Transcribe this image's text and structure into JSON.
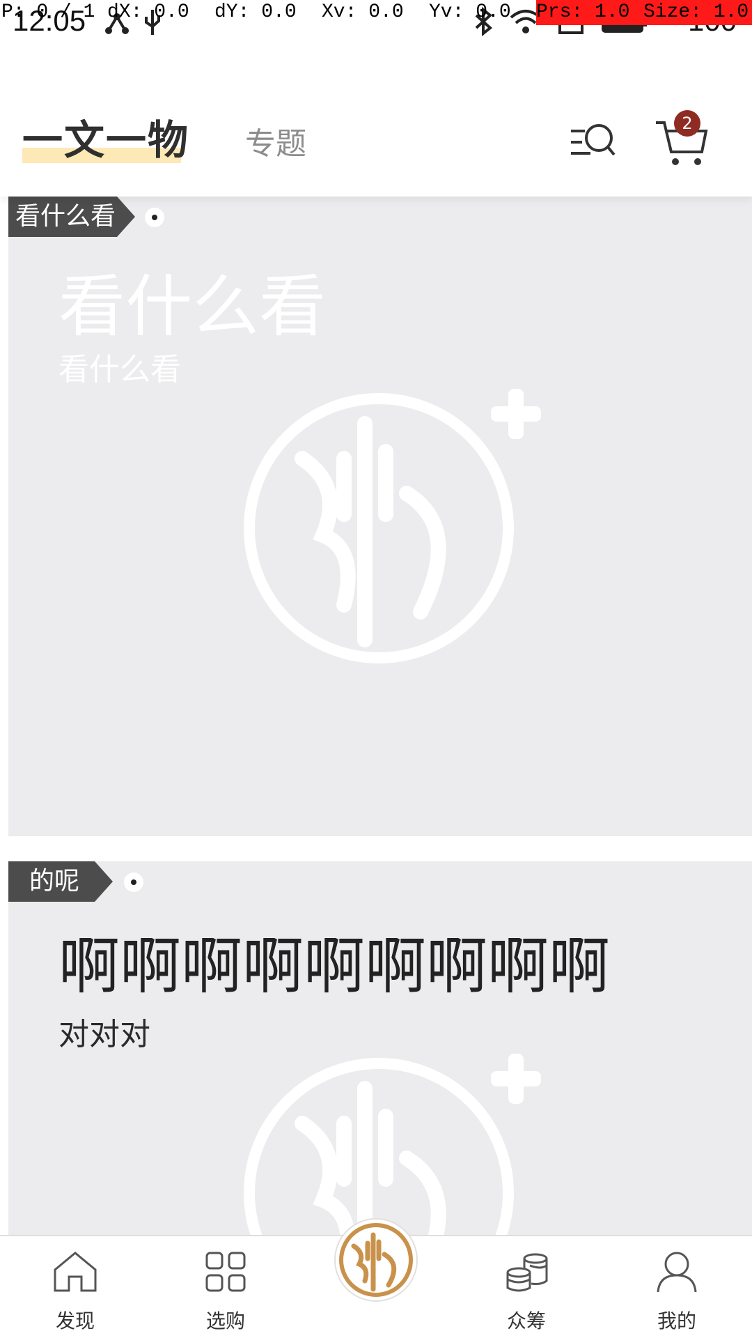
{
  "status_bar": {
    "time": "12:05",
    "battery": "100",
    "overlay": {
      "p": "P: 0 / 1",
      "dx": "dX: 0.0",
      "dy": "dY: 0.0",
      "xv": "Xv: 0.0",
      "yv": "Yv: 0.0",
      "prs": "Prs: 1.0",
      "size": "Size: 1.0"
    }
  },
  "header": {
    "tabs": [
      {
        "label": "一文一物",
        "active": true
      },
      {
        "label": "专题",
        "active": false
      }
    ],
    "search_icon": "search-list-icon",
    "cart_icon": "cart-icon",
    "cart_badge": "2"
  },
  "cards": [
    {
      "tag": "看什么看",
      "title": "看什么看",
      "subtitle": "看什么看"
    },
    {
      "tag": "的呢",
      "title": "啊啊啊啊啊啊啊啊啊",
      "subtitle": "对对对"
    }
  ],
  "bottom_nav": {
    "items": [
      {
        "label": "发现",
        "icon": "home-icon"
      },
      {
        "label": "选购",
        "icon": "grid-icon"
      },
      {
        "label": "",
        "icon": "center-logo-icon"
      },
      {
        "label": "众筹",
        "icon": "coins-icon"
      },
      {
        "label": "我的",
        "icon": "user-icon"
      }
    ]
  },
  "colors": {
    "accent": "#c9924b",
    "badge": "#8e2b22",
    "card_bg": "#ececee",
    "tab_highlight": "#fde9b5"
  }
}
